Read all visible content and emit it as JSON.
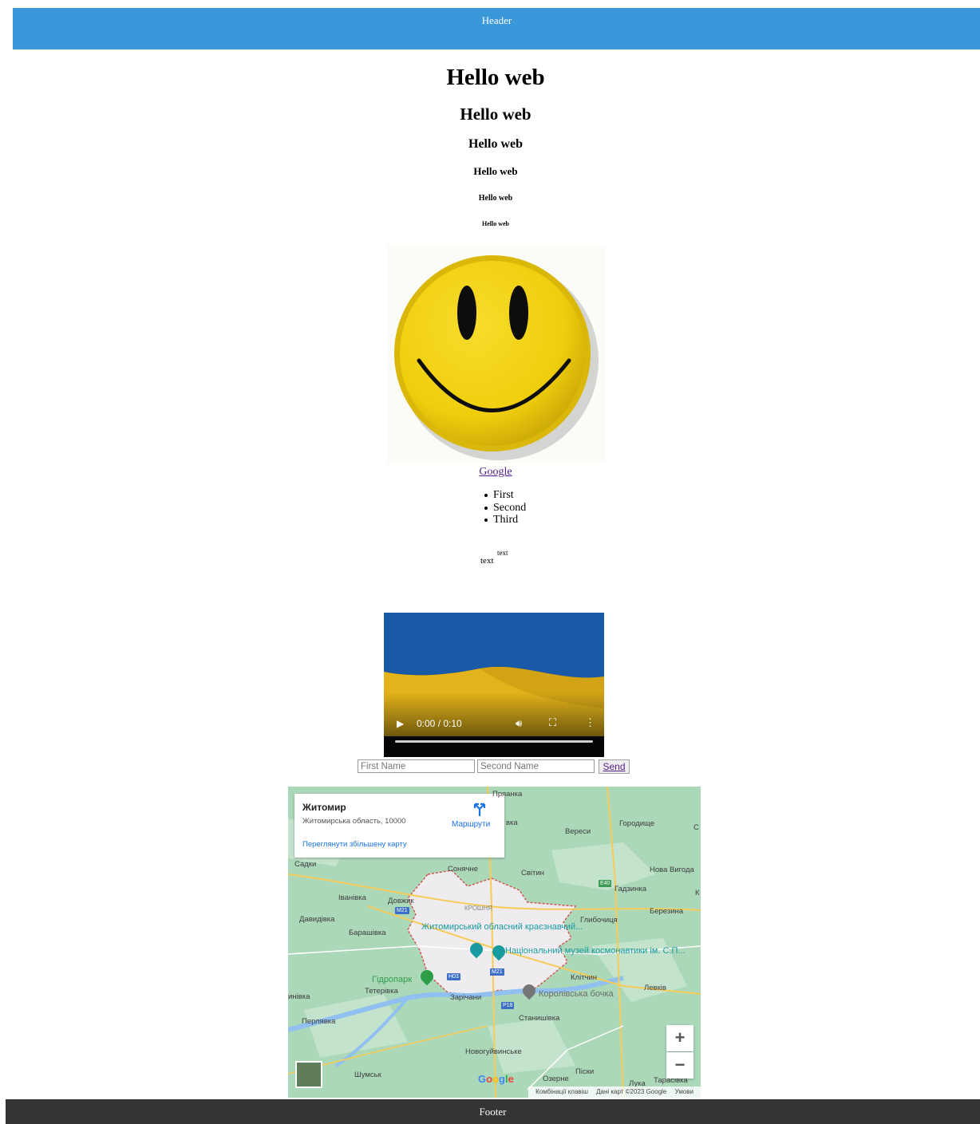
{
  "header": {
    "text": "Header"
  },
  "headings": [
    "Hello web",
    "Hello web",
    "Hello web",
    "Hello web",
    "Hello web",
    "Hello web"
  ],
  "link": {
    "label": "Google"
  },
  "list": {
    "items": [
      "First",
      "Second",
      "Third"
    ]
  },
  "text_sample": {
    "base": "text",
    "sup": "text"
  },
  "video": {
    "time": "0:00 / 0:10",
    "progress": 0
  },
  "form": {
    "first_placeholder": "First Name",
    "second_placeholder": "Second Name",
    "send_label": "Send"
  },
  "map": {
    "place_title": "Житомир",
    "place_sub": "Житомирська область, 10000",
    "routes_label": "Маршрути",
    "larger_map_link": "Переглянути збільшену карту",
    "labels": {
      "pryanka": "Пряанка",
      "vka": "вка",
      "veresy": "Вереси",
      "horodyshche": "Городище",
      "c": "С",
      "sadky": "Садки",
      "soniachne": "Сонячне",
      "svitin": "Світин",
      "nova_vyhoda": "Нова Вигода",
      "hadzynka": "Гадзинка",
      "k": "К",
      "ivanivka": "Іванівка",
      "dovzhyk": "Довжик",
      "kroshnia": "КРОШНЯ",
      "davydivka": "Давидівка",
      "berezyna": "Березина",
      "hlybochytsia": "Глибочиця",
      "barashivka": "Барашівка",
      "klitchyn": "Клітчин",
      "levkiv": "Левків",
      "teterivka": "Тетерівка",
      "zarichani": "Зарічани",
      "ynivka": "инівка",
      "stanyshivka": "Станишівка",
      "perliavka": "Перлявка",
      "novohuivynske": "Новогуйвинське",
      "shumsk": "Шумськ",
      "ozerne": "Озерне",
      "pisky": "Піски",
      "luka": "Лука",
      "tarasivka": "Тарасівка"
    },
    "pois": {
      "museum_regional": "Житомирський обласний краєзнавчий...",
      "museum_space": "Національний музей космонавтики ім. С.П...",
      "park": "Гідропарк",
      "brewery": "Королівська бочка"
    },
    "roads": {
      "m21a": "M21",
      "m21b": "M21",
      "h03": "H03",
      "p18": "P18",
      "e40": "E40"
    },
    "zoom_in": "+",
    "zoom_out": "−",
    "google": "Google",
    "attribution": [
      "Комбінації клавіш",
      "Дані карт ©2023 Google",
      "Умови"
    ]
  },
  "footer": {
    "text": "Footer"
  }
}
